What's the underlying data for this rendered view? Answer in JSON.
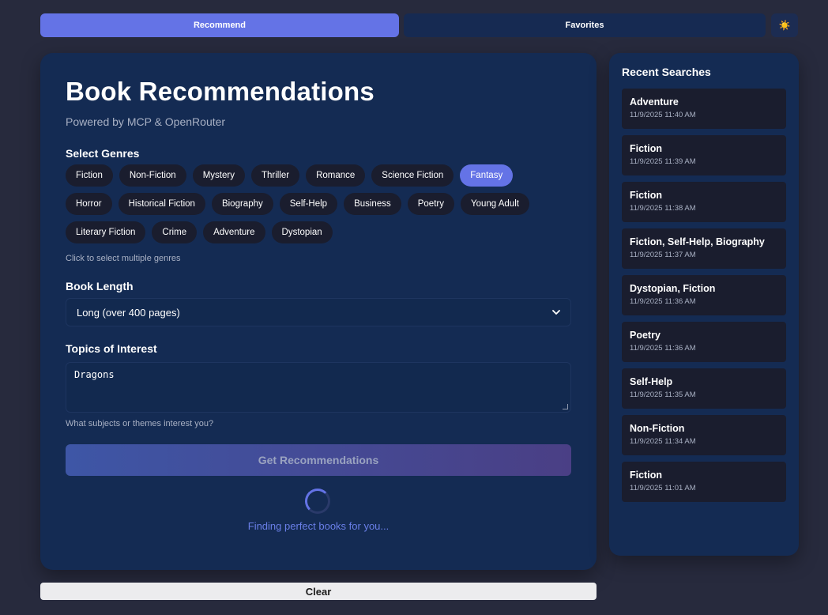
{
  "nav": {
    "recommend_label": "Recommend",
    "favorites_label": "Favorites",
    "theme_icon": "☀️"
  },
  "main": {
    "title": "Book Recommendations",
    "subtitle": "Powered by MCP & OpenRouter",
    "genres_label": "Select Genres",
    "genres_rows": [
      [
        {
          "label": "Fiction",
          "selected": false
        },
        {
          "label": "Non-Fiction",
          "selected": false
        },
        {
          "label": "Mystery",
          "selected": false
        },
        {
          "label": "Thriller",
          "selected": false
        },
        {
          "label": "Romance",
          "selected": false
        },
        {
          "label": "Science Fiction",
          "selected": false
        },
        {
          "label": "Fantasy",
          "selected": true
        }
      ],
      [
        {
          "label": "Horror",
          "selected": false
        },
        {
          "label": "Historical Fiction",
          "selected": false
        },
        {
          "label": "Biography",
          "selected": false
        },
        {
          "label": "Self-Help",
          "selected": false
        },
        {
          "label": "Business",
          "selected": false
        },
        {
          "label": "Poetry",
          "selected": false
        },
        {
          "label": "Young Adult",
          "selected": false
        }
      ],
      [
        {
          "label": "Literary Fiction",
          "selected": false
        },
        {
          "label": "Crime",
          "selected": false
        },
        {
          "label": "Adventure",
          "selected": false
        },
        {
          "label": "Dystopian",
          "selected": false
        }
      ]
    ],
    "genres_hint": "Click to select multiple genres",
    "length_label": "Book Length",
    "length_value": "Long (over 400 pages)",
    "topics_label": "Topics of Interest",
    "topics_value": "Dragons",
    "topics_hint": "What subjects or themes interest you?",
    "submit_label": "Get Recommendations",
    "loading_text": "Finding perfect books for you..."
  },
  "clear_label": "Clear",
  "sidebar": {
    "title": "Recent Searches",
    "items": [
      {
        "genres": "Adventure",
        "time": "11/9/2025 11:40 AM"
      },
      {
        "genres": "Fiction",
        "time": "11/9/2025 11:39 AM"
      },
      {
        "genres": "Fiction",
        "time": "11/9/2025 11:38 AM"
      },
      {
        "genres": "Fiction, Self-Help, Biography",
        "time": "11/9/2025 11:37 AM"
      },
      {
        "genres": "Dystopian, Fiction",
        "time": "11/9/2025 11:36 AM"
      },
      {
        "genres": "Poetry",
        "time": "11/9/2025 11:36 AM"
      },
      {
        "genres": "Self-Help",
        "time": "11/9/2025 11:35 AM"
      },
      {
        "genres": "Non-Fiction",
        "time": "11/9/2025 11:34 AM"
      },
      {
        "genres": "Fiction",
        "time": "11/9/2025 11:01 AM"
      }
    ]
  },
  "colors": {
    "accent": "#6473e6",
    "background": "#272a3d",
    "card": "#142b53",
    "chip": "#1a1d2e"
  }
}
